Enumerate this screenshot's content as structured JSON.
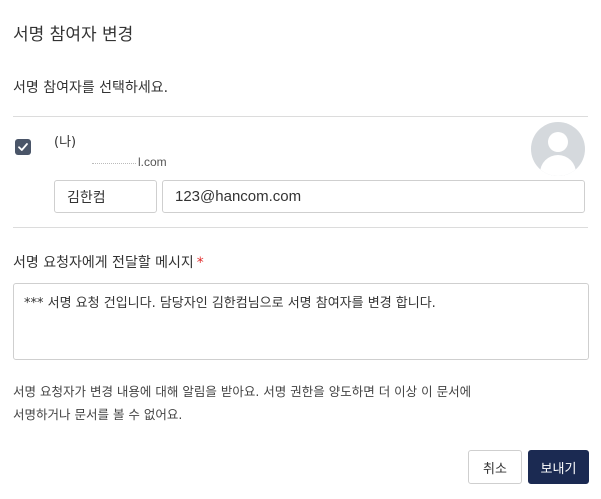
{
  "dialog": {
    "title": "서명 참여자 변경",
    "instruction": "서명 참여자를 선택하세요."
  },
  "participant": {
    "checked": true,
    "me_label": "(나)",
    "email_hint": "l.com",
    "name": "김한컴",
    "email": "123@hancom.com",
    "avatar_icon": "user-avatar-icon"
  },
  "message": {
    "label": "서명 요청자에게 전달할 메시지",
    "required_mark": "*",
    "text": "*** 서명 요청 건입니다. 담당자인 김한컴님으로 서명 참여자를 변경 합니다."
  },
  "notice": {
    "line1": "서명 요청자가 변경 내용에 대해 알림을 받아요. 서명 권한을 양도하면 더 이상 이 문서에",
    "line2": "서명하거나 문서를 볼 수 없어요."
  },
  "buttons": {
    "cancel": "취소",
    "send": "보내기"
  },
  "colors": {
    "primary": "#1b2a52",
    "required": "#e02b2b",
    "checkbox": "#4a5568"
  }
}
